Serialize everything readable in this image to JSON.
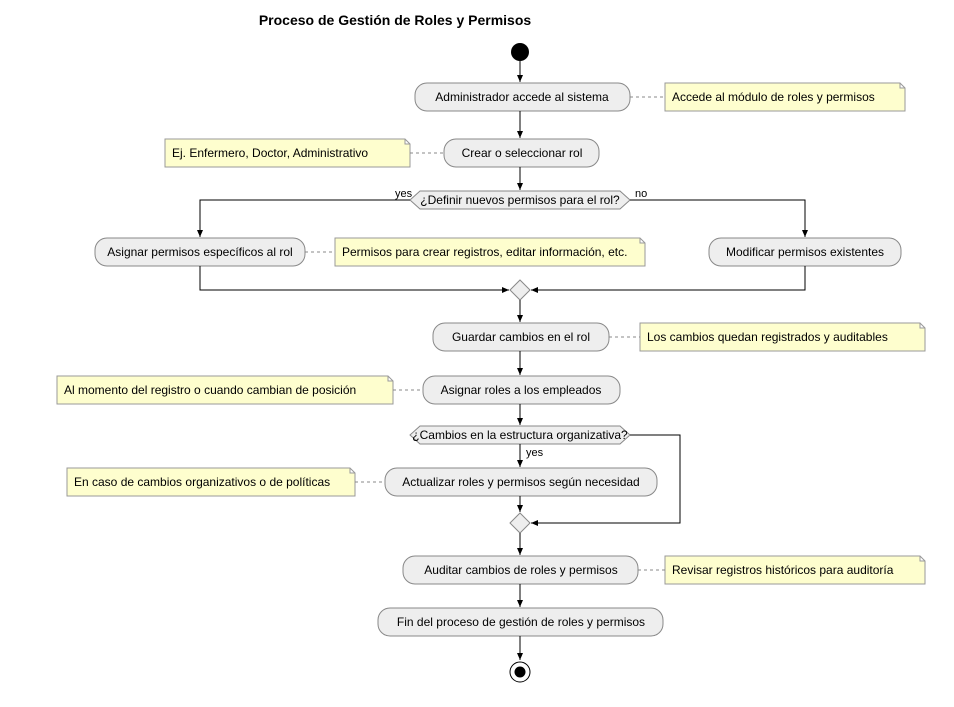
{
  "title": "Proceso de Gestión de Roles y Permisos",
  "nodes": {
    "admin_access": "Administrador accede al sistema",
    "create_select_role": "Crear o seleccionar rol",
    "decision_define": "¿Definir nuevos permisos para el rol?",
    "assign_specific": "Asignar permisos específicos al rol",
    "modify_existing": "Modificar permisos existentes",
    "save_changes": "Guardar cambios en el rol",
    "assign_roles": "Asignar roles a los empleados",
    "decision_org": "¿Cambios en la estructura organizativa?",
    "update_roles": "Actualizar roles y permisos según necesidad",
    "audit": "Auditar cambios de roles y permisos",
    "end_process": "Fin del proceso de gestión de roles y permisos"
  },
  "notes": {
    "note_access": "Accede al módulo de roles y permisos",
    "note_create": "Ej. Enfermero, Doctor, Administrativo",
    "note_assign_specific": "Permisos para crear registros, editar información, etc.",
    "note_save": "Los cambios quedan registrados y auditables",
    "note_assign_roles": "Al momento del registro o cuando cambian de posición",
    "note_update": "En caso de cambios organizativos o de políticas",
    "note_audit": "Revisar registros históricos para auditoría"
  },
  "labels": {
    "yes": "yes",
    "no": "no"
  }
}
